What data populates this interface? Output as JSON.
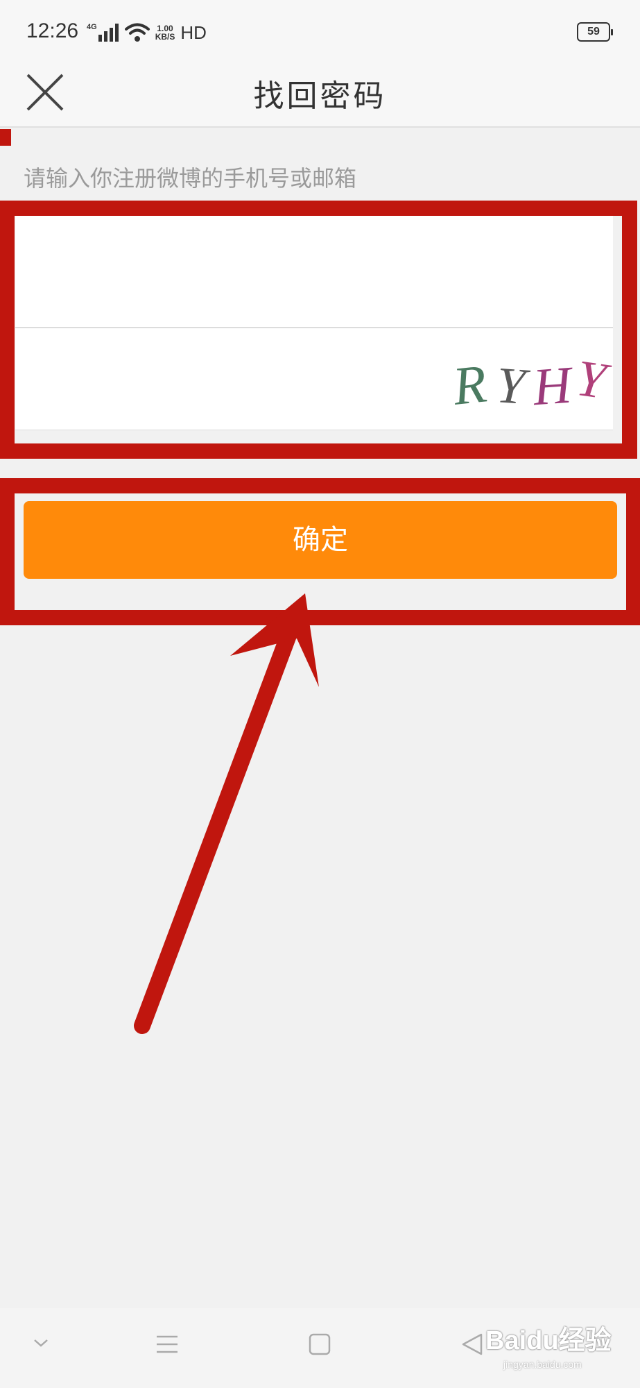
{
  "status_bar": {
    "time": "12:26",
    "network": "4G",
    "speed_value": "1.00",
    "speed_unit": "KB/S",
    "hd": "HD",
    "battery": "59"
  },
  "header": {
    "title": "找回密码",
    "close_icon": "close-icon"
  },
  "form": {
    "hint": "请输入你注册微博的手机号或邮箱",
    "phone_value": "",
    "captcha_value": "",
    "captcha_text": "RYHY"
  },
  "actions": {
    "confirm_label": "确定"
  },
  "bottom_nav": {
    "icons": [
      "back-chevron-icon",
      "menu-icon",
      "home-square-icon",
      "back-triangle-icon"
    ]
  },
  "watermark": {
    "brand": "Baidu经验",
    "url": "jingyan.baidu.com"
  },
  "colors": {
    "accent": "#ff8a0a",
    "annotation": "#c0160e"
  }
}
